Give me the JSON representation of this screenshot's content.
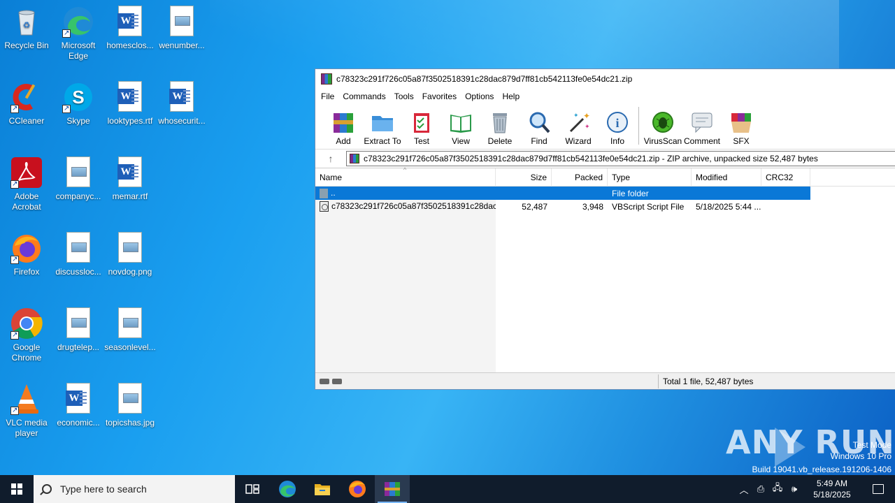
{
  "desktop": {
    "icons": [
      {
        "label": "Recycle Bin",
        "icon": "recycle-bin-icon"
      },
      {
        "label": "Microsoft Edge",
        "icon": "edge-icon"
      },
      {
        "label": "homesclos...",
        "icon": "word-doc-icon"
      },
      {
        "label": "wenumber...",
        "icon": "image-file-icon"
      },
      {
        "label": "CCleaner",
        "icon": "ccleaner-icon"
      },
      {
        "label": "Skype",
        "icon": "skype-icon"
      },
      {
        "label": "looktypes.rtf",
        "icon": "word-doc-icon"
      },
      {
        "label": "whosecurit...",
        "icon": "word-doc-icon"
      },
      {
        "label": "Adobe Acrobat",
        "icon": "acrobat-icon"
      },
      {
        "label": "companyc...",
        "icon": "image-file-icon"
      },
      {
        "label": "memar.rtf",
        "icon": "word-doc-icon"
      },
      {
        "label": "Firefox",
        "icon": "firefox-icon"
      },
      {
        "label": "discussloc...",
        "icon": "image-file-icon"
      },
      {
        "label": "novdog.png",
        "icon": "image-file-icon"
      },
      {
        "label": "Google Chrome",
        "icon": "chrome-icon"
      },
      {
        "label": "drugtelep...",
        "icon": "image-file-icon"
      },
      {
        "label": "seasonlevel...",
        "icon": "image-file-icon"
      },
      {
        "label": "VLC media player",
        "icon": "vlc-icon"
      },
      {
        "label": "economic...",
        "icon": "word-doc-icon"
      },
      {
        "label": "topicshas.jpg",
        "icon": "image-file-icon"
      }
    ]
  },
  "winrar": {
    "title": "c78323c291f726c05a87f3502518391c28dac879d7ff81cb542113fe0e54dc21.zip",
    "menu": [
      "File",
      "Commands",
      "Tools",
      "Favorites",
      "Options",
      "Help"
    ],
    "toolbar": [
      "Add",
      "Extract To",
      "Test",
      "View",
      "Delete",
      "Find",
      "Wizard",
      "Info",
      "VirusScan",
      "Comment",
      "SFX"
    ],
    "address": "c78323c291f726c05a87f3502518391c28dac879d7ff81cb542113fe0e54dc21.zip - ZIP archive, unpacked size 52,487 bytes",
    "columns": [
      "Name",
      "Size",
      "Packed",
      "Type",
      "Modified",
      "CRC32"
    ],
    "rows": [
      {
        "name": "..",
        "size": "",
        "packed": "",
        "type": "File folder",
        "modified": "",
        "crc": ""
      },
      {
        "name": "c78323c291f726c05a87f3502518391c28dac...",
        "size": "52,487",
        "packed": "3,948",
        "type": "VBScript Script File",
        "modified": "5/18/2025 5:44 ...",
        "crc": ""
      }
    ],
    "status": "Total 1 file, 52,487 bytes"
  },
  "watermark": {
    "brand": "ANY RUN",
    "testmode": "Test Mode",
    "edition": "Windows 10 Pro",
    "build": "Build 19041.vb_release.191206-1406"
  },
  "taskbar": {
    "search_placeholder": "Type here to search",
    "time": "5:49 AM",
    "date": "5/18/2025"
  },
  "colors": {
    "selection": "#0a78d7",
    "taskbar": "#101c2c"
  }
}
